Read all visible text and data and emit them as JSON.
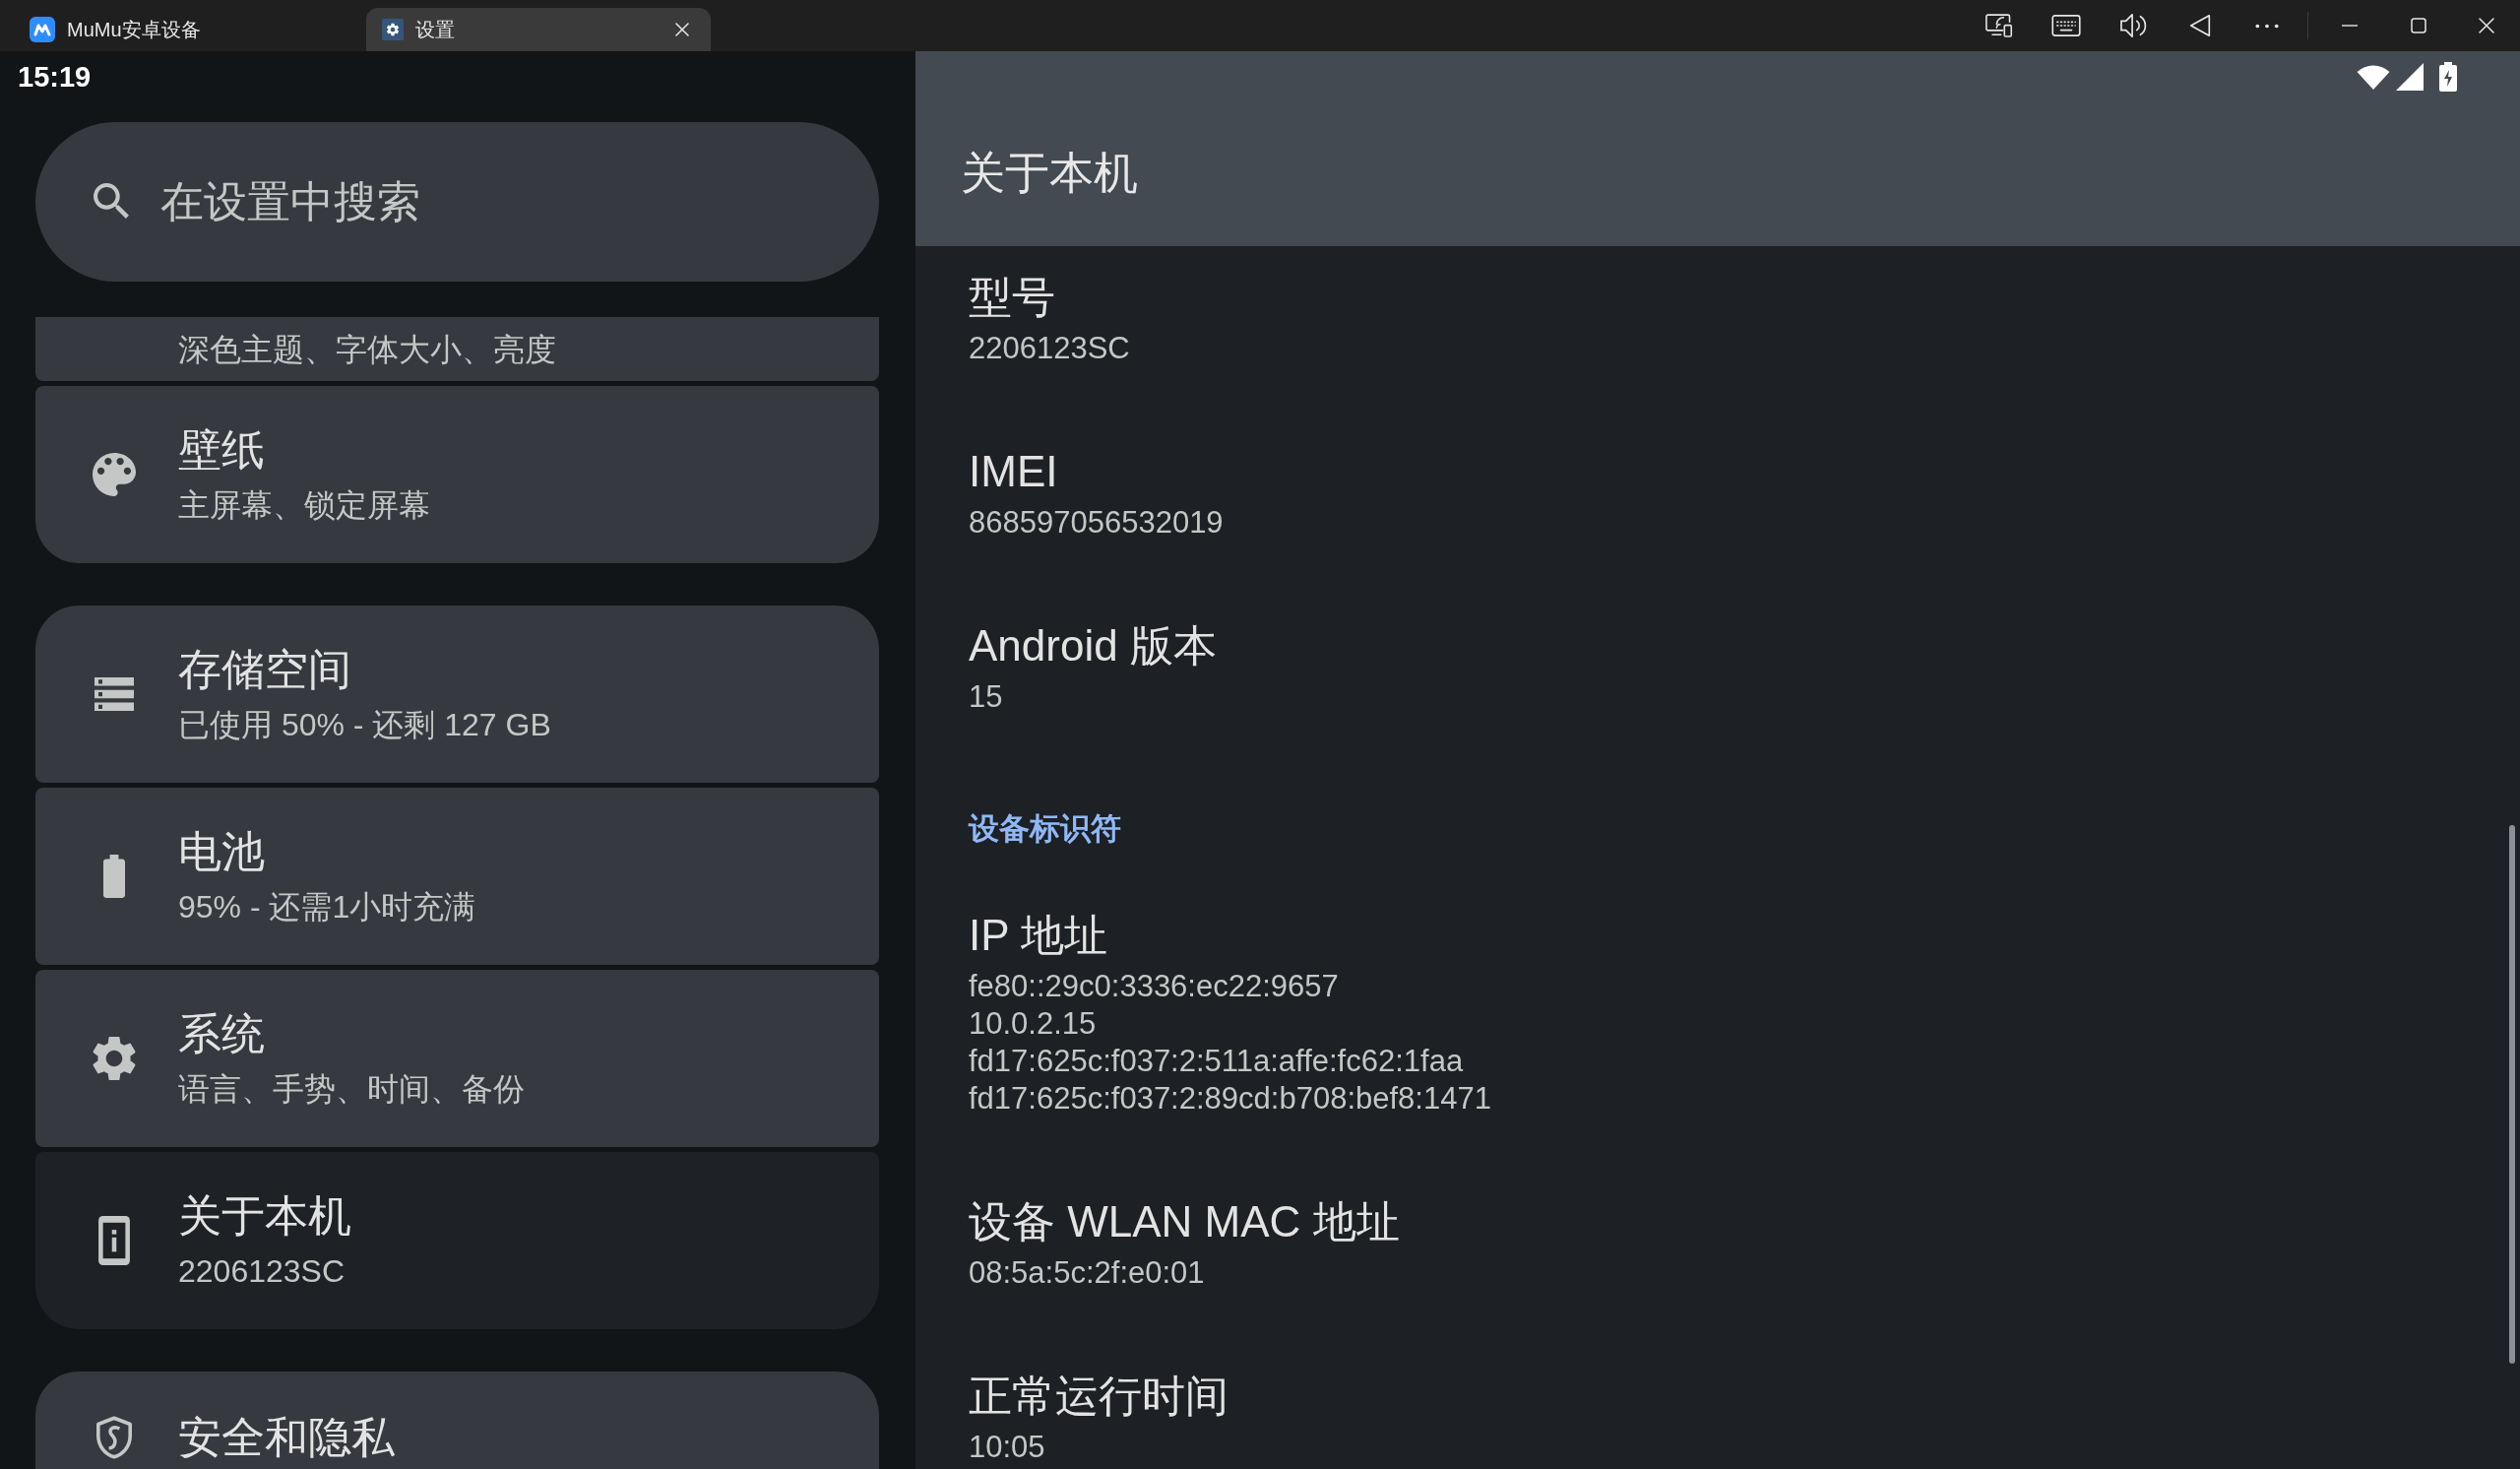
{
  "window": {
    "tabs": [
      {
        "kind": "launcher",
        "label": "MuMu安卓设备",
        "selected": false
      },
      {
        "kind": "app",
        "label": "设置",
        "selected": true
      }
    ]
  },
  "status_bar": {
    "time": "15:19"
  },
  "settings": {
    "search": {
      "placeholder": "在设置中搜索"
    },
    "groups": [
      {
        "items": [
          {
            "kind": "display",
            "subtitle": "深色主题、字体大小、亮度",
            "selected": false
          },
          {
            "kind": "wallpaper",
            "title": "壁纸",
            "subtitle": "主屏幕、锁定屏幕",
            "selected": false
          }
        ]
      },
      {
        "items": [
          {
            "kind": "storage",
            "title": "存储空间",
            "subtitle": "已使用 50% - 还剩 127 GB",
            "selected": false
          },
          {
            "kind": "battery",
            "title": "电池",
            "subtitle": "95% - 还需1小时充满",
            "selected": false
          },
          {
            "kind": "system",
            "title": "系统",
            "subtitle": "语言、手势、时间、备份",
            "selected": false
          },
          {
            "kind": "about",
            "title": "关于本机",
            "subtitle": "2206123SC",
            "selected": true
          }
        ]
      },
      {
        "items": [
          {
            "kind": "security",
            "title": "安全和隐私",
            "selected": false
          }
        ]
      }
    ]
  },
  "detail": {
    "title": "关于本机",
    "rows": [
      {
        "kind": "field",
        "label": "型号",
        "values": [
          "2206123SC"
        ]
      },
      {
        "kind": "field",
        "label": "IMEI",
        "values": [
          "868597056532019"
        ]
      },
      {
        "kind": "field",
        "label": "Android 版本",
        "values": [
          "15"
        ]
      },
      {
        "kind": "section",
        "label": "设备标识符"
      },
      {
        "kind": "field",
        "label": "IP 地址",
        "values": [
          "fe80::29c0:3336:ec22:9657",
          "10.0.2.15",
          "fd17:625c:f037:2:511a:affe:fc62:1faa",
          "fd17:625c:f037:2:89cd:b708:bef8:1471"
        ]
      },
      {
        "kind": "field",
        "label": "设备 WLAN MAC 地址",
        "values": [
          "08:5a:5c:2f:e0:01"
        ]
      },
      {
        "kind": "field",
        "label": "正常运行时间",
        "values": [
          "10:05"
        ]
      }
    ]
  }
}
